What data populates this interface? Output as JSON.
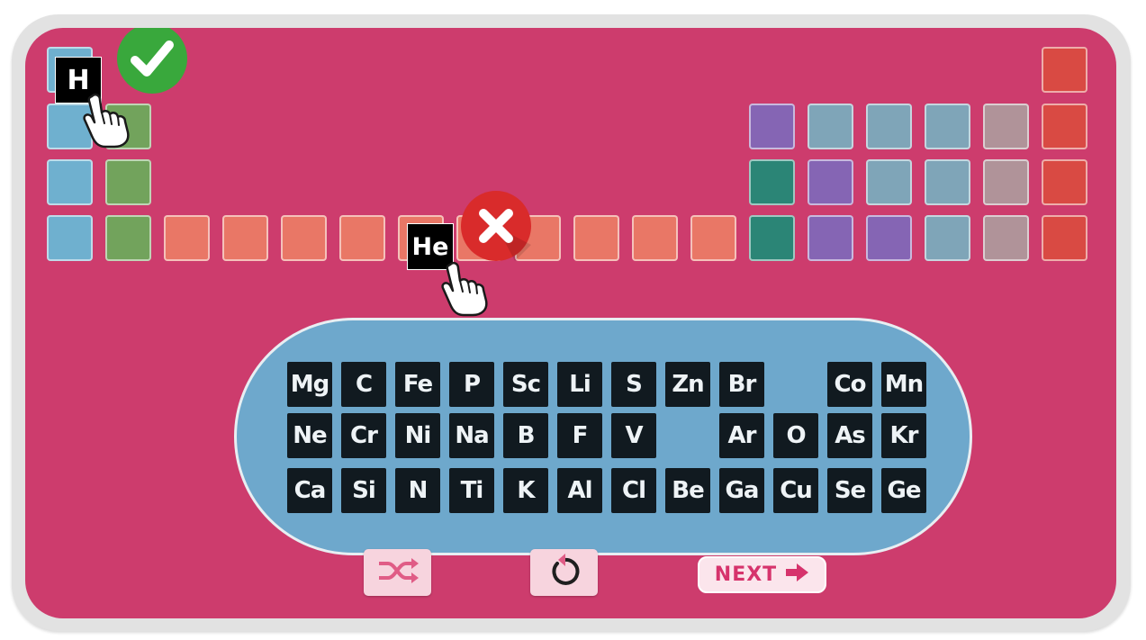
{
  "game": {
    "placed_correct": {
      "symbol": "H",
      "result": "correct"
    },
    "placed_wrong": {
      "symbol": "He",
      "result": "incorrect"
    }
  },
  "slot_colors": {
    "blue": "#6fb0cf",
    "green": "#72a35c",
    "salmon": "#e97766",
    "purple": "#8565b4",
    "teal": "#2b8576",
    "grayblue": "#7fa5b8",
    "mauve": "#b09399",
    "red": "#d94a43"
  },
  "tray": {
    "rows": [
      [
        "Mg",
        "C",
        "Fe",
        "P",
        "Sc",
        "Li",
        "S",
        "Zn",
        "Br",
        "",
        "Co",
        "Mn"
      ],
      [
        "Ne",
        "Cr",
        "Ni",
        "Na",
        "B",
        "F",
        "V",
        "",
        "Ar",
        "O",
        "As",
        "Kr"
      ],
      [
        "Ca",
        "Si",
        "N",
        "Ti",
        "K",
        "Al",
        "Cl",
        "Be",
        "Ga",
        "Cu",
        "Se",
        "Ge"
      ]
    ]
  },
  "controls": {
    "shuffle_icon": "shuffle-icon",
    "reset_icon": "reset-icon",
    "next_label": "NEXT",
    "next_icon": "arrow-right-icon"
  },
  "colors": {
    "board": "#cd3c6d",
    "tray": "#6ea8cc",
    "tile": "#111a20",
    "correct": "#39a83c",
    "incorrect": "#d92b2b",
    "accent": "#d6336c"
  }
}
